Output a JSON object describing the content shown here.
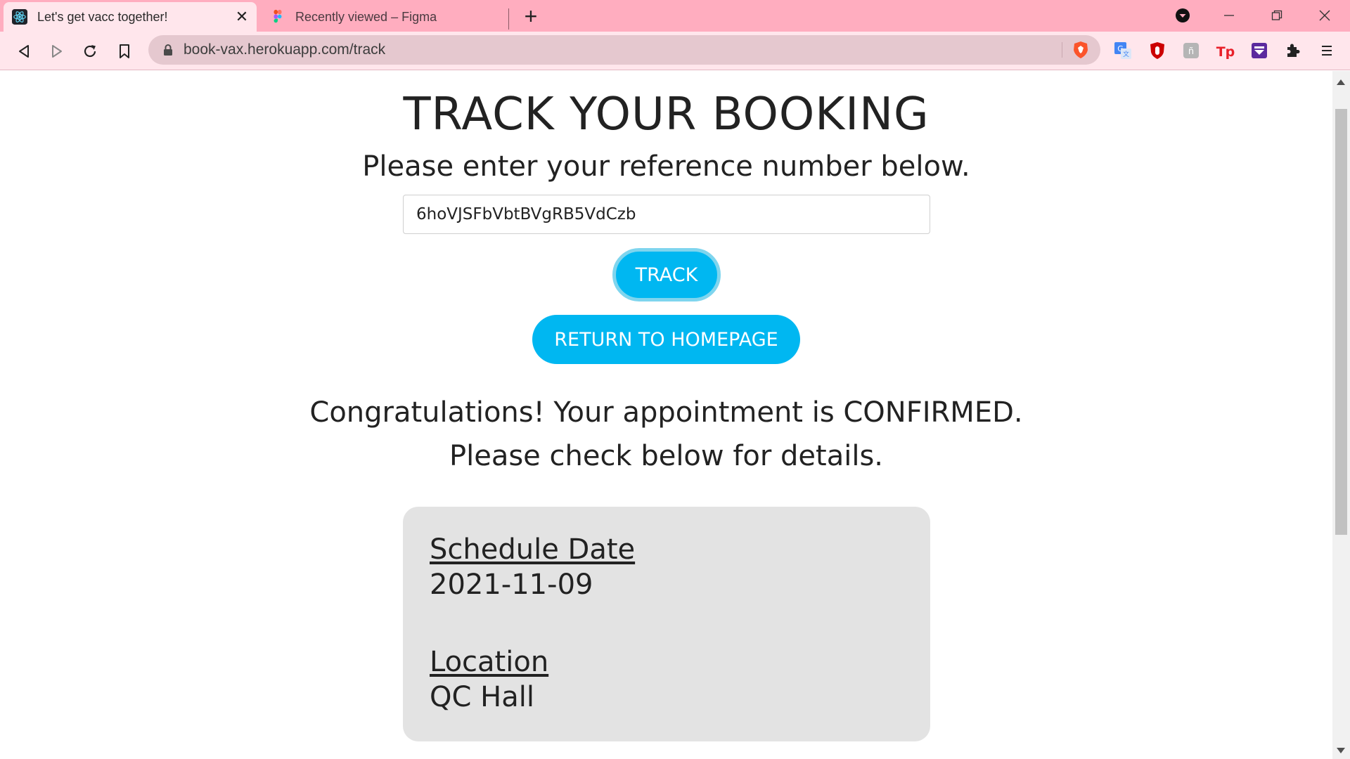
{
  "browser": {
    "tabs": [
      {
        "title": "Let's get vacc together!",
        "icon": "react-icon",
        "active": true
      },
      {
        "title": "Recently viewed – Figma",
        "icon": "figma-icon",
        "active": false
      }
    ],
    "url": "book-vax.herokuapp.com/track",
    "colors": {
      "tabbar": "#ffadbf",
      "toolbar": "#ffe6ec"
    }
  },
  "page": {
    "heading": "TRACK YOUR BOOKING",
    "instruction": "Please enter your reference number below.",
    "reference_number": "6hoVJSFbVbtBVgRB5VdCzb",
    "track_label": "TRACK",
    "home_label": "RETURN TO HOMEPAGE",
    "confirmation_line1": "Congratulations! Your appointment is CONFIRMED.",
    "confirmation_line2": "Please check below for details.",
    "details": {
      "schedule_label": "Schedule Date",
      "schedule_value": "2021-11-09",
      "location_label": "Location",
      "location_value": "QC Hall"
    },
    "accent_color": "#00b7f1"
  }
}
